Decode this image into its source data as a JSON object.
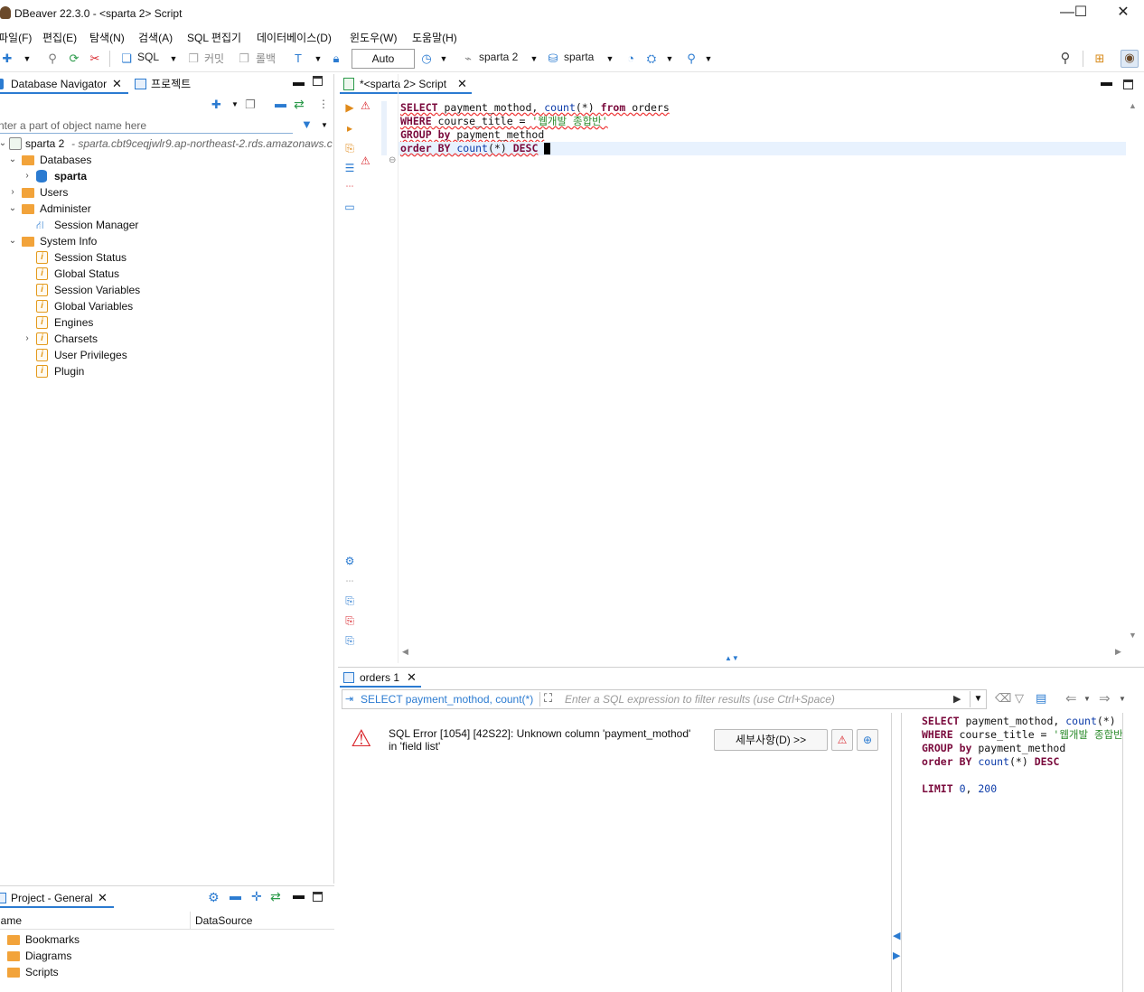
{
  "window": {
    "title": "DBeaver 22.3.0 - <sparta 2> Script",
    "minimize": "—",
    "maximize": "☐",
    "close": "✕"
  },
  "menu": [
    "파일(F)",
    "편집(E)",
    "탐색(N)",
    "검색(A)",
    "SQL 편집기",
    "데이터베이스(D)",
    "윈도우(W)",
    "도움말(H)"
  ],
  "toolbar": {
    "sql_label": "SQL",
    "commit_label": "커밋",
    "rollback_label": "롤백",
    "tx_mode": "Auto",
    "connection": "sparta 2",
    "schema": "sparta"
  },
  "navigator": {
    "tab_label": "Database Navigator",
    "project_tab_label": "프로젝트",
    "filter_placeholder": "nter a part of object name here",
    "connection_name": "sparta 2",
    "connection_host": "- sparta.cbt9ceqjwlr9.ap-northeast-2.rds.amazonaws.c",
    "databases": "Databases",
    "db_sparta": "sparta",
    "users": "Users",
    "administer": "Administer",
    "session_manager": "Session Manager",
    "system_info": "System Info",
    "sysinfo_items": [
      "Session Status",
      "Global Status",
      "Session Variables",
      "Global Variables",
      "Engines",
      "Charsets",
      "User Privileges",
      "Plugin"
    ]
  },
  "project": {
    "tab_label": "Project - General",
    "col_name": "lame",
    "col_datasource": "DataSource",
    "items": [
      "Bookmarks",
      "Diagrams",
      "Scripts"
    ]
  },
  "editor": {
    "tab_label": "*<sparta 2> Script",
    "lines": {
      "l1a": "SELECT",
      "l1b": " payment_mothod, ",
      "l1c": "count",
      "l1d": "(*) ",
      "l1e": "from",
      "l1f": " orders",
      "l2a": "WHERE",
      "l2b": " course_title = ",
      "l2c": "'웹개발 종합반'",
      "l3a": "GROUP",
      "l3b": " ",
      "l3c": "by",
      "l3d": " payment_method",
      "l4a": "order",
      "l4b": " ",
      "l4c": "BY",
      "l4d": " ",
      "l4e": "count",
      "l4f": "(*) ",
      "l4g": "DESC"
    }
  },
  "results": {
    "tab_label": "orders 1",
    "query_preview": "SELECT payment_mothod, count(*)",
    "filter_placeholder": "Enter a SQL expression to filter results (use Ctrl+Space)",
    "error_line1": "SQL Error [1054] [42S22]: Unknown column 'payment_mothod'",
    "error_line2": "in 'field list'",
    "details_button": "세부사항(D) >>",
    "sql_panel": {
      "l1a": "SELECT",
      "l1b": " payment_mothod, ",
      "l1c": "count",
      "l1d": "(*)",
      "l2a": "WHERE",
      "l2b": " course_title = ",
      "l2c": "'웹개발 종합반",
      "l3a": "GROUP",
      "l3b": " ",
      "l3c": "by",
      "l3d": " payment_method",
      "l4a": "order",
      "l4b": " ",
      "l4c": "BY",
      "l4d": " ",
      "l4e": "count",
      "l4f": "(*) ",
      "l4g": "DESC",
      "l5a": "LIMIT",
      "l5b": " ",
      "l5c": "0",
      "l5d": ", ",
      "l5e": "200"
    }
  },
  "colors": {
    "keyword": "#7a0a3c",
    "string": "#2a8a2a",
    "number": "#0b3aa8",
    "error": "#d9262c",
    "accent": "#2b7bd1"
  }
}
